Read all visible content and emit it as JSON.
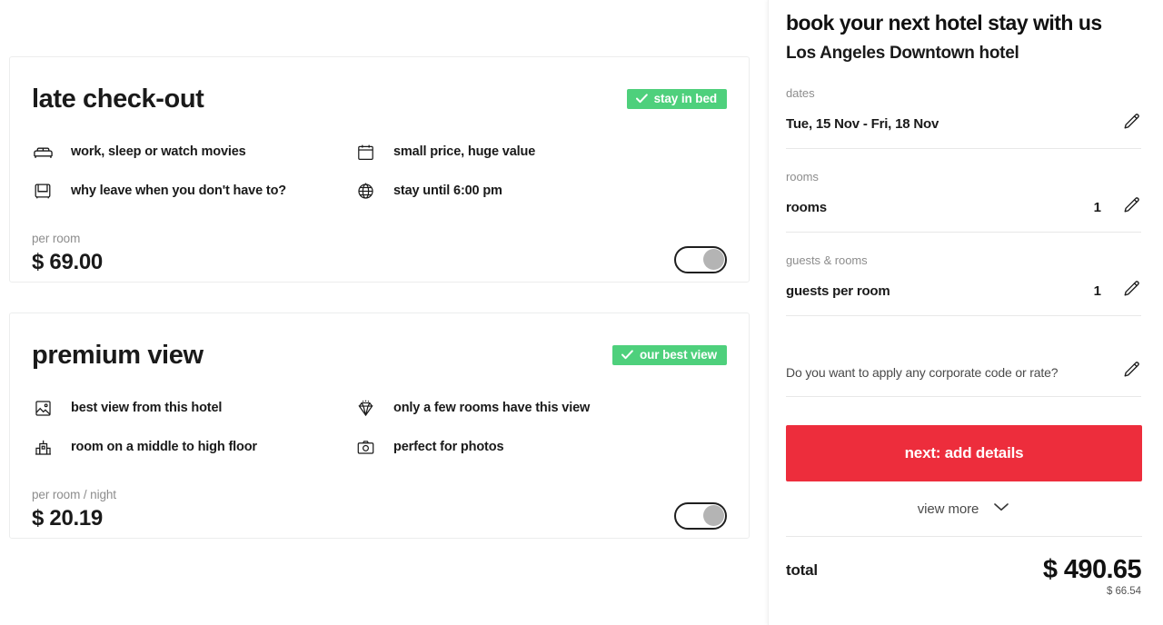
{
  "offers": [
    {
      "id": "late-check-out",
      "title": "late check-out",
      "badge": "stay in bed",
      "badge_icon": "check-icon",
      "features": [
        {
          "icon": "bed-icon",
          "label": "work, sleep or watch movies"
        },
        {
          "icon": "calendar-icon",
          "label": "small price, huge value"
        },
        {
          "icon": "armchair-icon",
          "label": "why leave when you don't have to?"
        },
        {
          "icon": "globe-icon",
          "label": "stay until 6:00 pm"
        }
      ],
      "price_unit": "per room",
      "price_value": "$ 69.00",
      "toggle_state": "off"
    },
    {
      "id": "premium-view",
      "title": "premium view",
      "badge": "our best view",
      "badge_icon": "check-icon",
      "features": [
        {
          "icon": "image-icon",
          "label": "best view from this hotel"
        },
        {
          "icon": "diamond-icon",
          "label": "only a few rooms have this view"
        },
        {
          "icon": "building-icon",
          "label": "room on a middle to high floor"
        },
        {
          "icon": "camera-icon",
          "label": "perfect for photos"
        }
      ],
      "price_unit": "per room / night",
      "price_value": "$ 20.19",
      "toggle_state": "off"
    }
  ],
  "booking": {
    "title": "book your next hotel stay with us",
    "hotel": "Los Angeles Downtown hotel",
    "dates": {
      "caption": "dates",
      "value": "Tue, 15 Nov - Fri, 18 Nov",
      "edit_icon": "pencil-icon"
    },
    "rooms": {
      "caption": "rooms",
      "label": "rooms",
      "count": "1",
      "edit_icon": "pencil-icon"
    },
    "guests": {
      "caption": "guests & rooms",
      "label": "guests per room",
      "count": "1",
      "edit_icon": "pencil-icon"
    },
    "corporate": {
      "prompt": "Do you want to apply any corporate code or rate?",
      "edit_icon": "pencil-icon"
    },
    "cta_label": "next: add details",
    "view_more_label": "view more",
    "view_more_icon": "chevron-down-icon",
    "total": {
      "label": "total",
      "amount": "$ 490.65",
      "sub_amount": "$ 66.54"
    }
  },
  "colors": {
    "accent_red": "#ED2D3C",
    "badge_green": "#4ED07C",
    "text_primary": "#1A1A1A",
    "text_muted": "#8D8D8D",
    "border": "#E8E8E8"
  }
}
